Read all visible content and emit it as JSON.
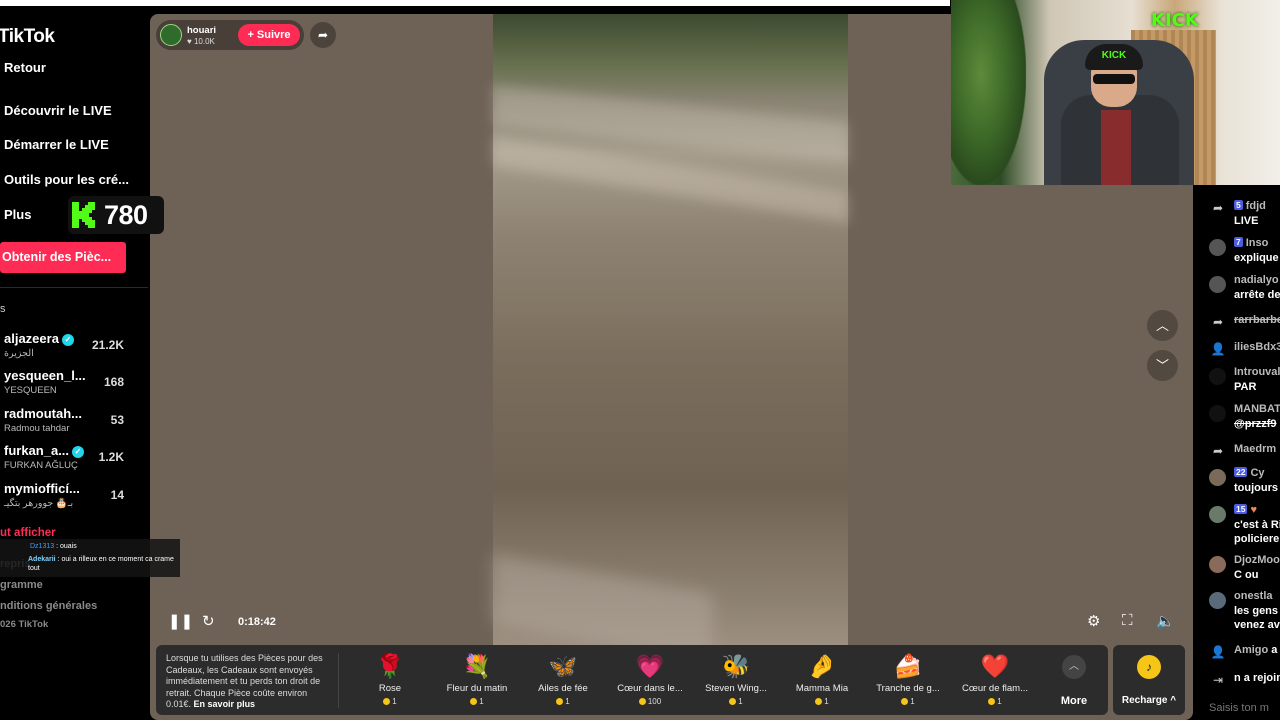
{
  "app": {
    "logo": "TikTok"
  },
  "sidebar": {
    "nav": [
      {
        "label": "Retour"
      },
      {
        "label": "Découvrir le LIVE"
      },
      {
        "label": "Démarrer le LIVE"
      },
      {
        "label": "Outils pour les cré..."
      },
      {
        "label": "Plus"
      }
    ],
    "coins_button": "Obtenir des Pièc...",
    "section_mark": "s",
    "accounts": [
      {
        "name": "aljazeera",
        "sub": "الجزيرة",
        "count": "21.2K",
        "verified": true
      },
      {
        "name": "yesqueen_l...",
        "sub": "YESQUEEN",
        "count": "168",
        "verified": false
      },
      {
        "name": "radmoutah...",
        "sub": "Radmou tahdar",
        "count": "53",
        "verified": false
      },
      {
        "name": "furkan_a...",
        "sub": "FURKAN AĞLUÇ",
        "count": "1.2K",
        "verified": true
      },
      {
        "name": "mymiofficí...",
        "sub": "بـ🎂 جوورهر بتگيـ",
        "count": "14",
        "verified": false
      }
    ],
    "show_all": "ut afficher",
    "footer": [
      "repris",
      "gramme",
      "nditions générales",
      "026 TikTok"
    ]
  },
  "kick_overlay": {
    "count": "780",
    "accent": "#53fc18"
  },
  "chat_overlay": {
    "line1_user": "Dz1313",
    "line1_text": " : ouais",
    "line2_user": "Adekarii",
    "line2_text": " : oui a rilleux en ce moment ca crame tout"
  },
  "stream": {
    "host_name": "houari",
    "host_likes": "♥ 10.0K",
    "follow_label": "+ Suivre",
    "time": "0:18:42"
  },
  "gifts": {
    "info_text": "Lorsque tu utilises des Pièces pour des Cadeaux, les Cadeaux sont envoyés immédiatement et tu perds ton droit de retrait. Chaque Pièce coûte environ 0.01€.",
    "info_link": "En savoir plus",
    "items": [
      {
        "icon": "🌹",
        "name": "Rose",
        "price": "1"
      },
      {
        "icon": "💐",
        "name": "Fleur du matin",
        "price": "1"
      },
      {
        "icon": "🦋",
        "name": "Ailes de fée",
        "price": "1"
      },
      {
        "icon": "💗",
        "name": "Cœur dans le...",
        "price": "100"
      },
      {
        "icon": "🐝",
        "name": "Steven Wing...",
        "price": "1"
      },
      {
        "icon": "🤌",
        "name": "Mamma Mia",
        "price": "1"
      },
      {
        "icon": "🍰",
        "name": "Tranche de g...",
        "price": "1"
      },
      {
        "icon": "❤️",
        "name": "Cœur de flam...",
        "price": "1"
      }
    ],
    "more_label": "More",
    "recharge_label": "Recharge ^"
  },
  "webcam": {
    "sign": "KICK",
    "cap": "KICK"
  },
  "chat": {
    "messages": [
      {
        "type": "share",
        "level": "5",
        "user": "fdjd",
        "text": "LIVE"
      },
      {
        "type": "avatar",
        "level": "7",
        "user": "Inso",
        "text": "explique"
      },
      {
        "type": "avatar",
        "level": "",
        "user": "nadialyo",
        "text": "arrête de"
      },
      {
        "type": "share",
        "level": "",
        "user": "rarrbarbe",
        "text": ""
      },
      {
        "type": "follow",
        "level": "",
        "user": "iliesBdx3",
        "text": ""
      },
      {
        "type": "dark",
        "level": "",
        "user": "Introuval",
        "text": "PAR"
      },
      {
        "type": "dark",
        "level": "",
        "user": "MANBAT",
        "text": "@przzf9"
      },
      {
        "type": "share",
        "level": "",
        "user": "Maedrm",
        "text": ""
      },
      {
        "type": "avatar",
        "level": "22",
        "user": "Cy",
        "text": "toujours"
      },
      {
        "type": "avatar",
        "level": "15",
        "user": "",
        "text": "c'est à Ri\npoliciere"
      },
      {
        "type": "avatar",
        "level": "",
        "user": "DjozMoo",
        "text": "C ou"
      },
      {
        "type": "avatar",
        "level": "",
        "user": "onestla",
        "text": "les gens\nvenez av"
      },
      {
        "type": "follow",
        "level": "",
        "user": "Amigo",
        "text": "a"
      },
      {
        "type": "join",
        "level": "",
        "user": "n",
        "text": "a rejoint"
      }
    ],
    "input_placeholder": "Saisis ton m"
  }
}
